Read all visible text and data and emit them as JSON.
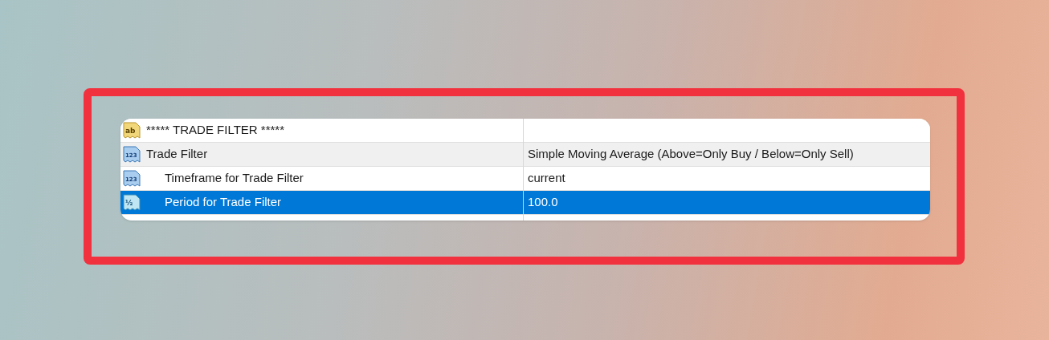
{
  "rows": [
    {
      "kind": "string",
      "icon_text": "ab",
      "name": "***** TRADE FILTER *****",
      "selected": false,
      "shaded": false
    },
    {
      "kind": "integer",
      "icon_text": "123",
      "name": "Trade Filter",
      "value": "Simple Moving Average (Above=Only Buy / Below=Only Sell)",
      "selected": false,
      "shaded": true,
      "children": [
        {
          "kind": "integer",
          "icon_text": "123",
          "name": "Timeframe for Trade Filter",
          "value": "current",
          "selected": false,
          "shaded": false
        },
        {
          "kind": "double",
          "icon_text": "½",
          "name": "Period for Trade Filter",
          "value": "100.0",
          "selected": true,
          "shaded": false
        }
      ]
    }
  ]
}
